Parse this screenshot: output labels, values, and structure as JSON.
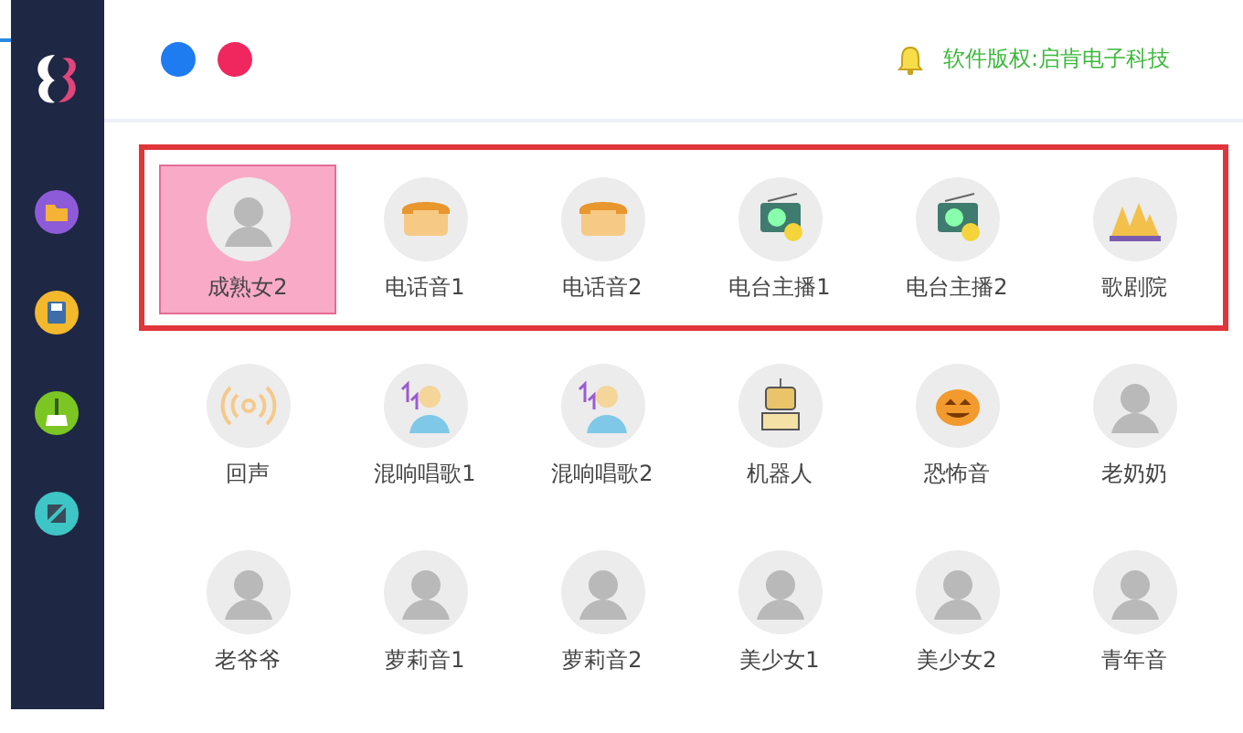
{
  "header": {
    "copyright": "软件版权:启肯电子科技"
  },
  "rows": [
    {
      "outlined": true,
      "items": [
        {
          "label": "成熟女2",
          "kind": "person",
          "selected": true
        },
        {
          "label": "电话音1",
          "kind": "phone",
          "selected": false
        },
        {
          "label": "电话音2",
          "kind": "phone",
          "selected": false
        },
        {
          "label": "电台主播1",
          "kind": "radio",
          "selected": false
        },
        {
          "label": "电台主播2",
          "kind": "radio",
          "selected": false
        },
        {
          "label": "歌剧院",
          "kind": "opera",
          "selected": false
        }
      ]
    },
    {
      "outlined": false,
      "items": [
        {
          "label": "回声",
          "kind": "echo",
          "selected": false
        },
        {
          "label": "混响唱歌1",
          "kind": "singer",
          "selected": false
        },
        {
          "label": "混响唱歌2",
          "kind": "singer",
          "selected": false
        },
        {
          "label": "机器人",
          "kind": "robot",
          "selected": false
        },
        {
          "label": "恐怖音",
          "kind": "pumpkin",
          "selected": false
        },
        {
          "label": "老奶奶",
          "kind": "person",
          "selected": false
        }
      ]
    },
    {
      "outlined": false,
      "items": [
        {
          "label": "老爷爷",
          "kind": "person",
          "selected": false
        },
        {
          "label": "萝莉音1",
          "kind": "person",
          "selected": false
        },
        {
          "label": "萝莉音2",
          "kind": "person",
          "selected": false
        },
        {
          "label": "美少女1",
          "kind": "person",
          "selected": false
        },
        {
          "label": "美少女2",
          "kind": "person",
          "selected": false
        },
        {
          "label": "青年音",
          "kind": "person",
          "selected": false
        }
      ]
    }
  ]
}
